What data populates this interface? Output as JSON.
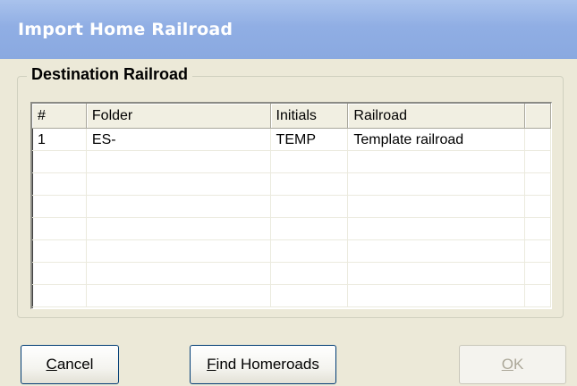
{
  "window": {
    "title": "Import Home Railroad"
  },
  "group": {
    "label": "Destination Railroad"
  },
  "table": {
    "columns": [
      "#",
      "Folder",
      "Initials",
      "Railroad",
      ""
    ],
    "rows": [
      [
        "1",
        "ES-",
        "TEMP",
        "Template railroad",
        ""
      ],
      [
        "",
        "",
        "",
        "",
        ""
      ],
      [
        "",
        "",
        "",
        "",
        ""
      ],
      [
        "",
        "",
        "",
        "",
        ""
      ],
      [
        "",
        "",
        "",
        "",
        ""
      ],
      [
        "",
        "",
        "",
        "",
        ""
      ],
      [
        "",
        "",
        "",
        "",
        ""
      ],
      [
        "",
        "",
        "",
        "",
        ""
      ]
    ]
  },
  "buttons": {
    "cancel": {
      "mnemonic": "C",
      "rest": "ancel"
    },
    "find": {
      "mnemonic": "F",
      "rest": "ind Homeroads"
    },
    "ok": {
      "mnemonic": "O",
      "rest": "K",
      "enabled": false
    }
  }
}
